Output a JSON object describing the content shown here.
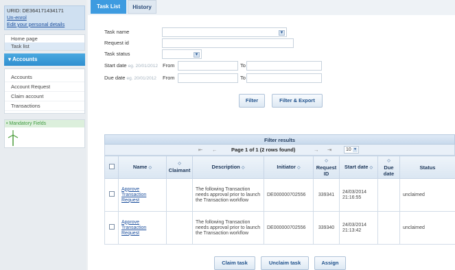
{
  "sidebar": {
    "urid": "URID: DE364171434171",
    "unenrol": "Un-enrol",
    "edit_details": "Edit your personal details",
    "nav": [
      "Home page",
      "Task list"
    ],
    "accounts_header": "Accounts",
    "accounts_items": [
      "Accounts",
      "Account Request",
      "Claim account",
      "Transactions"
    ],
    "mandatory": "• Mandatory Fields"
  },
  "tabs": {
    "active": "Task List",
    "inactive": "History"
  },
  "form": {
    "task_name": "Task name",
    "request_id": "Request id",
    "task_status": "Task status",
    "start_date": "Start date",
    "start_hint": "eg. 20/01/2012",
    "due_date": "Due date",
    "due_hint": "eg. 20/01/2012",
    "from": "From",
    "to": "To"
  },
  "buttons": {
    "filter": "Filter",
    "filter_export": "Filter & Export"
  },
  "results": {
    "title": "Filter results",
    "pager_text": "Page 1 of 1 (2 rows found)",
    "page_size": "10",
    "columns": {
      "name": "Name",
      "claimant": "Claimant",
      "description": "Description",
      "initiator": "Initiator",
      "request_id": "Request ID",
      "start_date": "Start date",
      "due_date": "Due date",
      "status": "Status"
    },
    "rows": [
      {
        "name": "Approve Transaction Request",
        "claimant": "",
        "description": "The following Transaction needs approval prior to launch the Transaction workflow",
        "initiator": "DE000000702556",
        "request_id": "339341",
        "start_date": "24/03/2014 21:16:55",
        "due_date": "",
        "status": "unclaimed"
      },
      {
        "name": "Approve Transaction Request",
        "claimant": "",
        "description": "The following Transaction needs approval prior to launch the Transaction workflow",
        "initiator": "DE000000702556",
        "request_id": "339340",
        "start_date": "24/03/2014 21:13:42",
        "due_date": "",
        "status": "unclaimed"
      }
    ]
  },
  "actions": {
    "claim": "Claim task",
    "unclaim": "Unclaim task",
    "assign": "Assign"
  }
}
